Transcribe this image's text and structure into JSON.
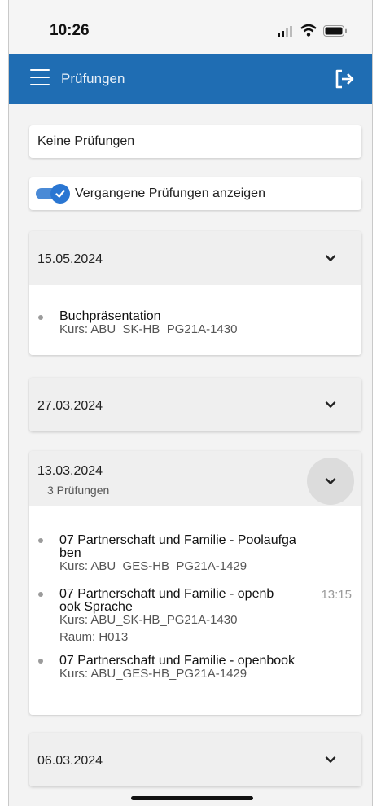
{
  "status_bar": {
    "time": "10:26"
  },
  "app_bar": {
    "title": "Prüfungen"
  },
  "filters": {
    "no_exams_text": "Keine Prüfungen",
    "toggle_label": "Vergangene Prüfungen anzeigen",
    "toggle_on": true
  },
  "panels": [
    {
      "date": "15.05.2024",
      "entries": [
        {
          "title": "Buchpräsentation",
          "kurs": "Kurs: ABU_SK-HB_PG21A-1430"
        }
      ]
    },
    {
      "date": "27.03.2024"
    },
    {
      "date": "13.03.2024",
      "subtitle": "3 Prüfungen",
      "entries": [
        {
          "title_line1": "07 Partnerschaft und Familie - Poolaufga",
          "title_line2": "ben",
          "kurs": "Kurs: ABU_GES-HB_PG21A-1429"
        },
        {
          "title_line1": "07 Partnerschaft und Familie - openb",
          "title_line2": "ook Sprache",
          "time": "13:15",
          "kurs": "Kurs: ABU_SK-HB_PG21A-1430",
          "raum": "Raum: H013"
        },
        {
          "title": "07 Partnerschaft und Familie - openbook",
          "kurs": "Kurs: ABU_GES-HB_PG21A-1429"
        }
      ]
    },
    {
      "date": "06.03.2024"
    }
  ],
  "colors": {
    "app_bar": "#1f6db3",
    "toggle": "#2a76d2",
    "background": "#f3f3f3"
  }
}
